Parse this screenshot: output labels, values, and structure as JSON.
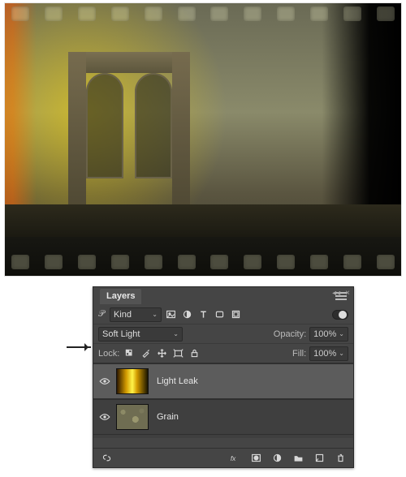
{
  "panel": {
    "title": "Layers",
    "filter_label_prefix": "Kind",
    "blend_mode": "Soft Light",
    "opacity_label": "Opacity:",
    "opacity_value": "100%",
    "lock_label": "Lock:",
    "fill_label": "Fill:",
    "fill_value": "100%"
  },
  "filter_icons": [
    "image-icon",
    "adjustment-icon",
    "type-icon",
    "shape-icon",
    "smartobject-icon"
  ],
  "lock_icons": [
    "lock-transparent-icon",
    "lock-brush-icon",
    "lock-move-icon",
    "lock-artboard-icon",
    "lock-all-icon"
  ],
  "layers": [
    {
      "name": "Light Leak",
      "thumb": "leak",
      "visible": true,
      "selected": true
    },
    {
      "name": "Grain",
      "thumb": "grain",
      "visible": true,
      "selected": false
    }
  ],
  "footer_icons": [
    "link-icon",
    "fx-icon",
    "mask-icon",
    "fill-adjust-icon",
    "group-icon",
    "new-layer-icon",
    "trash-icon"
  ]
}
